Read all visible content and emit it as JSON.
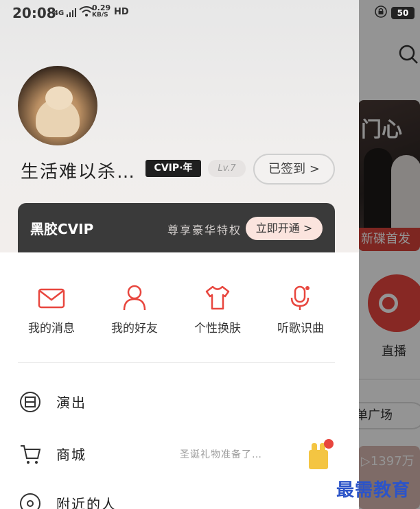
{
  "status_bar": {
    "time": "20:08",
    "network_type": "4G",
    "speed_value": "0.29",
    "speed_unit": "KB/S",
    "hd": "HD",
    "battery": "50"
  },
  "background_app": {
    "banner_title": "门心",
    "banner_tag": "新碟首发",
    "live_label": "直播",
    "playlist_pill": "单广场",
    "play_count": "▷1397万"
  },
  "profile": {
    "username": "生活难以杀…",
    "vip_badge": "CVIP·年",
    "level": "Lv.7",
    "signin_button": "已签到 >"
  },
  "vip_card": {
    "title": "黑胶CVIP",
    "subtitle": "尊享豪华特权",
    "open_button": "立即开通 >"
  },
  "quick_actions": [
    {
      "label": "我的消息",
      "icon": "mail-icon"
    },
    {
      "label": "我的好友",
      "icon": "person-icon"
    },
    {
      "label": "个性换肤",
      "icon": "tshirt-icon"
    },
    {
      "label": "听歌识曲",
      "icon": "mic-icon"
    }
  ],
  "menu": [
    {
      "label": "演出",
      "icon": "ticket-icon"
    },
    {
      "label": "商城",
      "icon": "cart-icon",
      "hint": "圣诞礼物准备了…"
    },
    {
      "label": "附近的人",
      "icon": "location-icon"
    }
  ],
  "watermark": "最需教育",
  "colors": {
    "accent": "#e8463e",
    "vip_card": "#3a3a3a",
    "watermark": "#2c54c8"
  }
}
